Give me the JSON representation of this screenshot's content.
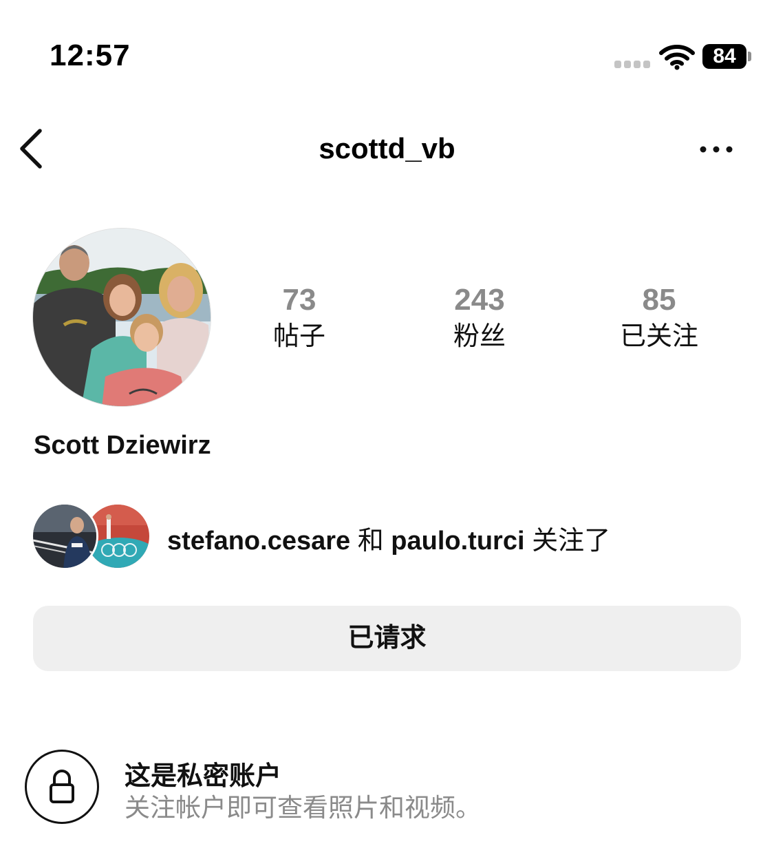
{
  "status_bar": {
    "time": "12:57",
    "battery_level": "84",
    "signal_icon": "cellular-signal-icon",
    "wifi_icon": "wifi-icon",
    "battery_icon": "battery-icon"
  },
  "nav": {
    "username": "scottd_vb",
    "back_icon": "chevron-left-icon",
    "more_icon": "ellipsis-icon"
  },
  "profile": {
    "display_name": "Scott Dziewirz",
    "stats": [
      {
        "value": "73",
        "label": "帖子"
      },
      {
        "value": "243",
        "label": "粉丝"
      },
      {
        "value": "85",
        "label": "已关注"
      }
    ]
  },
  "followed_by": {
    "user_1": "stefano.cesare",
    "connector": "和",
    "user_2": "paulo.turci",
    "suffix": "关注了"
  },
  "actions": {
    "requested_label": "已请求"
  },
  "private_notice": {
    "title": "这是私密账户",
    "description": "关注帐户即可查看照片和视频。",
    "icon": "lock-icon"
  },
  "colors": {
    "text_primary": "#111111",
    "text_secondary": "#8a8a8a",
    "button_bg": "#efefef",
    "background": "#ffffff"
  }
}
